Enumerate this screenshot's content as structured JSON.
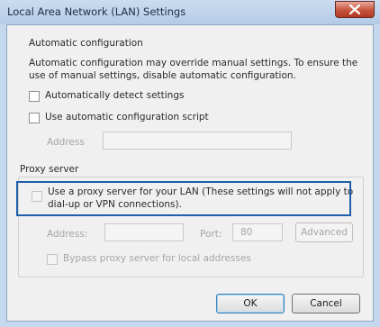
{
  "window": {
    "title": "Local Area Network (LAN) Settings",
    "accent": "#1f5ea8"
  },
  "automatic_configuration": {
    "group_title": "Automatic configuration",
    "description_line1": "Automatic configuration may override manual settings.  To ensure the",
    "description_line2": "use of manual settings, disable automatic configuration.",
    "auto_detect_label": "Automatically detect settings",
    "auto_detect_checked": false,
    "use_script_label": "Use automatic configuration script",
    "use_script_checked": false,
    "address_label": "Address",
    "address_value": ""
  },
  "proxy_server": {
    "group_title": "Proxy server",
    "use_proxy_line1": "Use a proxy server for your LAN (These settings will not apply to",
    "use_proxy_line2": "dial-up or VPN connections).",
    "use_proxy_checked": false,
    "address_label": "Address:",
    "address_value": "",
    "port_label": "Port:",
    "port_value": "80",
    "advanced_label": "Advanced",
    "bypass_label": "Bypass proxy server for local addresses",
    "bypass_checked": false
  },
  "buttons": {
    "ok_label": "OK",
    "cancel_label": "Cancel"
  }
}
